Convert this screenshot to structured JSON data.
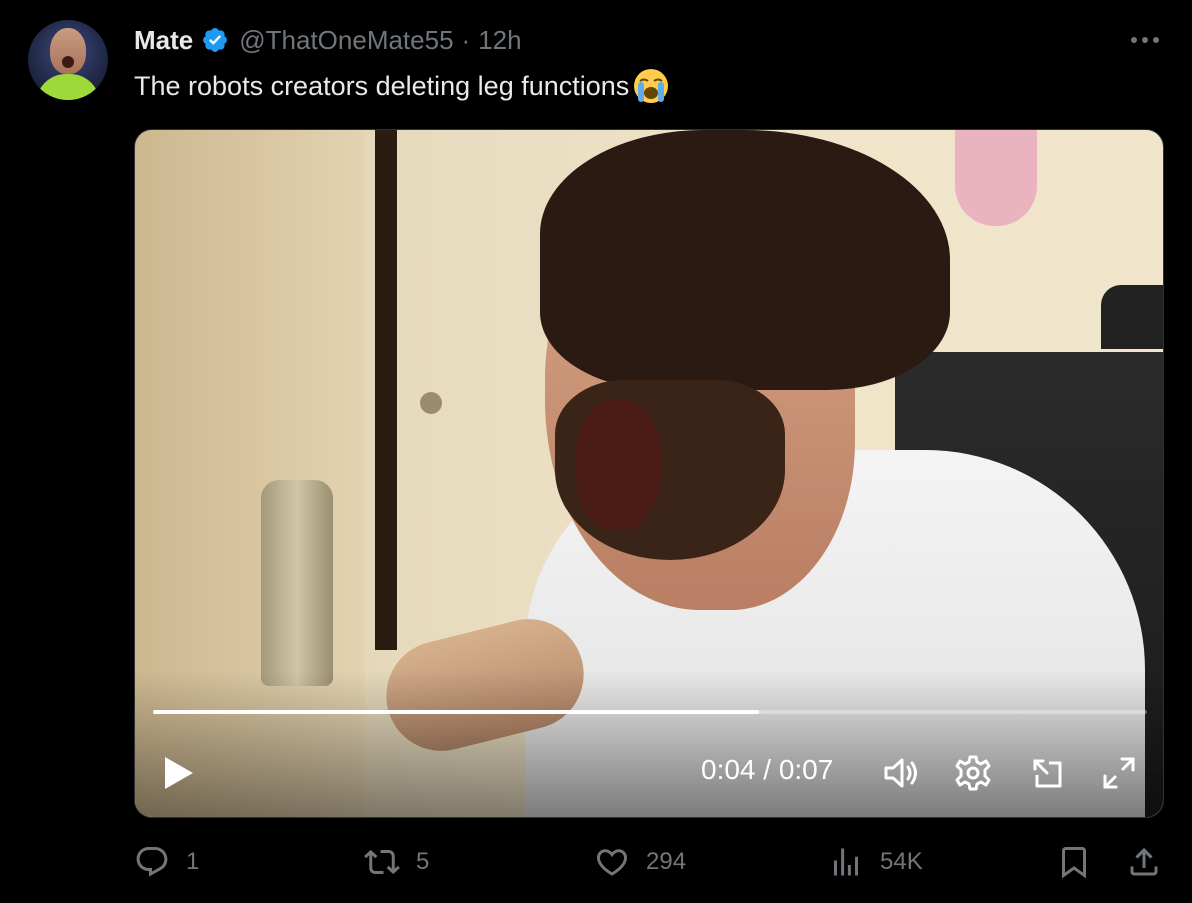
{
  "author": {
    "name": "Mate",
    "handle": "@ThatOneMate55",
    "separator": "·",
    "time": "12h",
    "verified": true
  },
  "tweet": {
    "text": "The robots creators deleting leg functions",
    "emoji": "loudly-crying-face"
  },
  "video": {
    "current_time": "0:04",
    "duration": "0:07",
    "time_display": "0:04 / 0:07",
    "progress": 0.61
  },
  "actions": {
    "replies": "1",
    "reposts": "5",
    "likes": "294",
    "views": "54K"
  },
  "colors": {
    "background": "#000000",
    "primary_text": "#e7e9ea",
    "secondary_text": "#71767b",
    "verified_badge": "#1d9bf0"
  },
  "icons": [
    "verified-badge-icon",
    "more-icon",
    "play-icon",
    "volume-icon",
    "settings-icon",
    "popout-icon",
    "fullscreen-icon",
    "reply-icon",
    "repost-icon",
    "like-icon",
    "views-icon",
    "bookmark-icon",
    "share-icon"
  ]
}
